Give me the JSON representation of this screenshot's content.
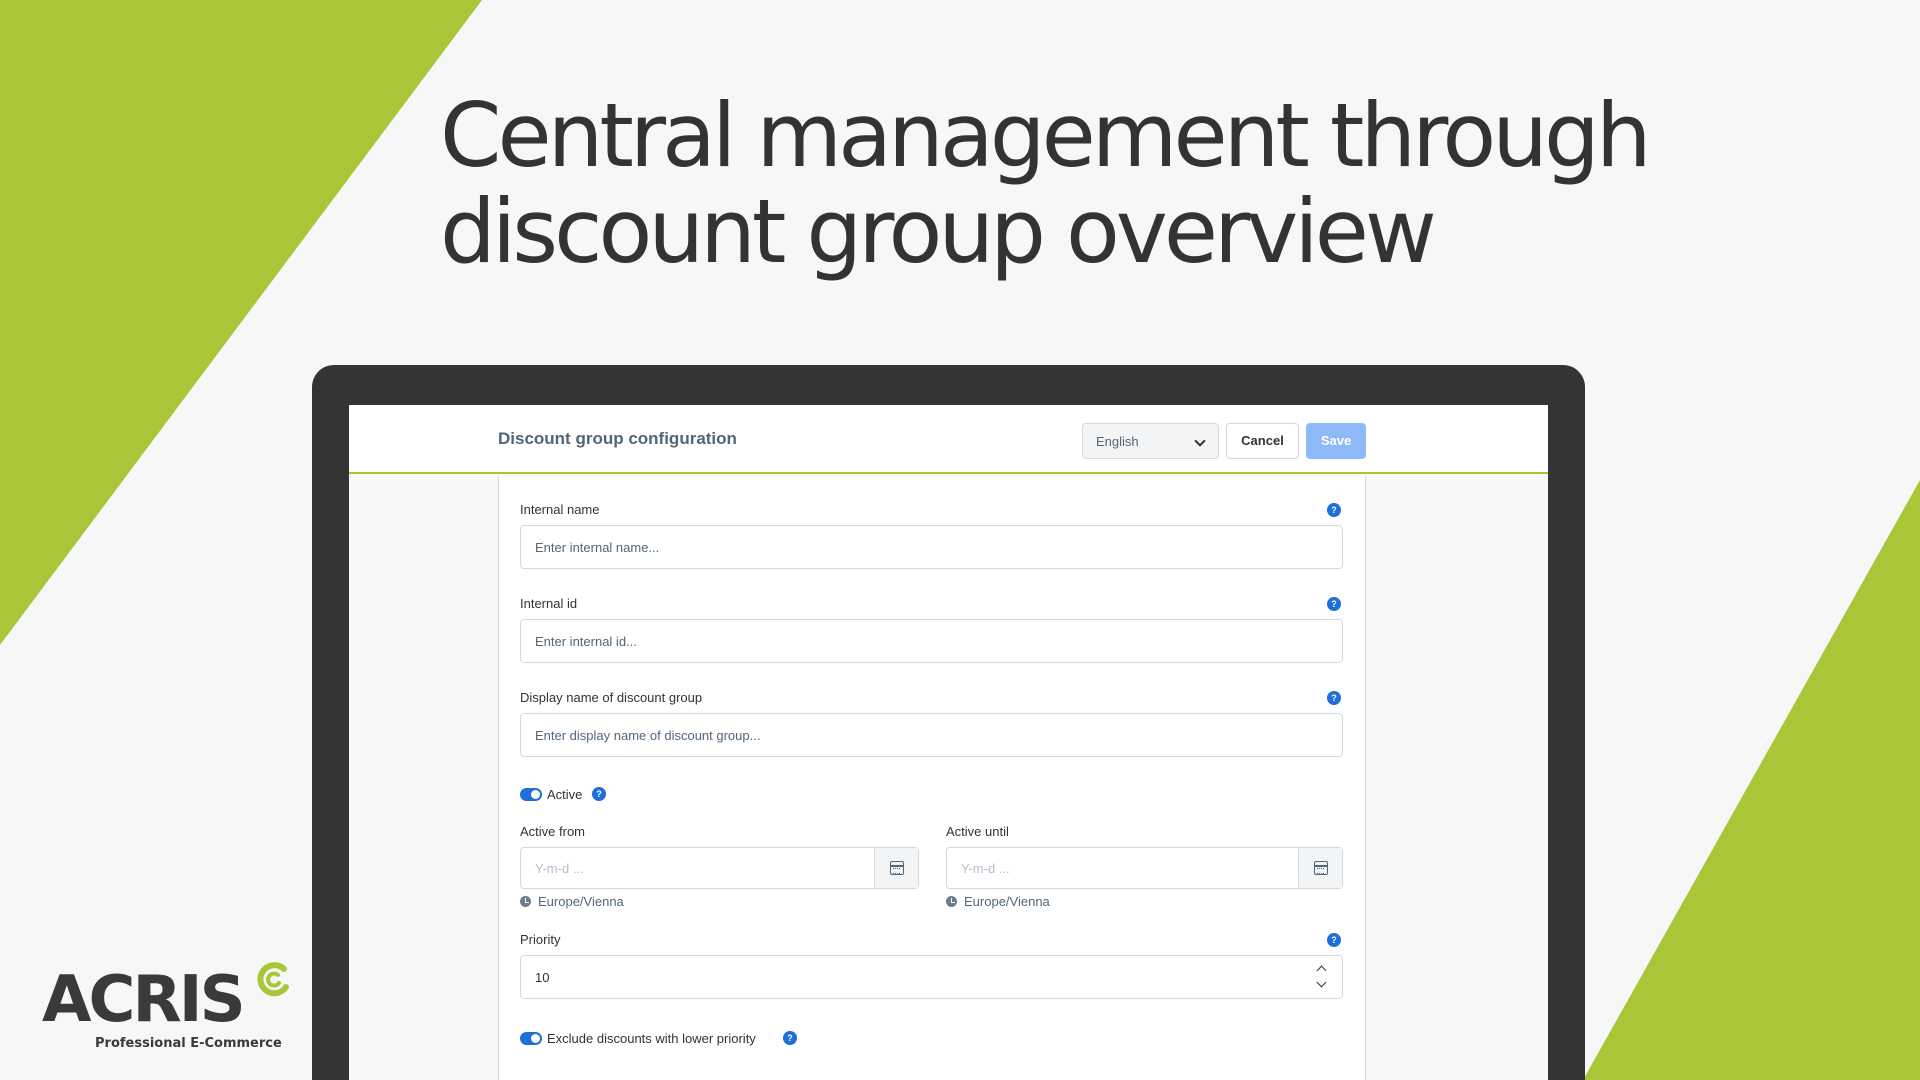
{
  "colors": {
    "brand_green": "#a8c638",
    "primary_blue": "#1e6fd9",
    "save_disabled": "#8db9f8",
    "laptop_frame": "#343434",
    "headline_text": "#333333"
  },
  "headline": {
    "line1": "Central management through",
    "line2": "discount group overview"
  },
  "header": {
    "title": "Discount group configuration",
    "language": "English",
    "cancel_label": "Cancel",
    "save_label": "Save"
  },
  "form": {
    "internal_name": {
      "label": "Internal name",
      "placeholder": "Enter internal name..."
    },
    "internal_id": {
      "label": "Internal id",
      "placeholder": "Enter internal id..."
    },
    "display_name": {
      "label": "Display name of discount group",
      "placeholder": "Enter display name of discount group..."
    },
    "active": {
      "label": "Active",
      "checked": true
    },
    "active_from": {
      "label": "Active from",
      "placeholder": "Y-m-d ...",
      "timezone": "Europe/Vienna"
    },
    "active_until": {
      "label": "Active until",
      "placeholder": "Y-m-d ...",
      "timezone": "Europe/Vienna"
    },
    "priority": {
      "label": "Priority",
      "value": "10"
    },
    "exclude_lower": {
      "label": "Exclude discounts with lower priority",
      "checked": true
    }
  },
  "icons": {
    "help": "question-circle-icon",
    "calendar": "calendar-icon",
    "clock": "clock-icon",
    "chevron": "chevron-down-icon"
  },
  "help_glyph": "?",
  "logo": {
    "name": "ACRIS",
    "tagline": "Professional E-Commerce"
  }
}
